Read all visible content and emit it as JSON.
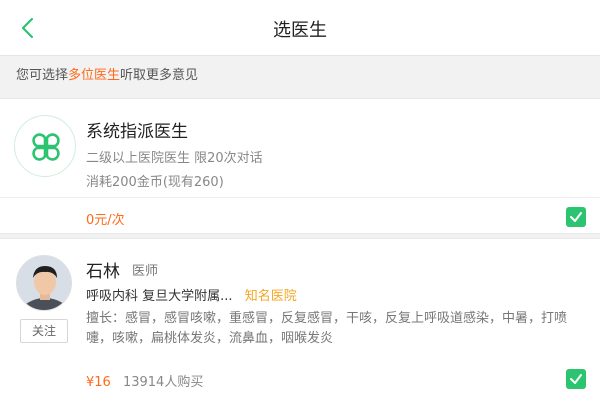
{
  "header": {
    "title": "选医生",
    "back_icon": "chevron-left-icon"
  },
  "hint": {
    "prefix": "您可选择",
    "highlight": "多位医生",
    "suffix": "听取更多意见"
  },
  "system_card": {
    "logo_icon": "clover-icon",
    "name": "系统指派医生",
    "desc": "二级以上医院医生 限20次对话",
    "cost": "消耗200金币(现有260)",
    "price": "0元/次",
    "checked": true
  },
  "doctor_card": {
    "name": "石林",
    "title": "医师",
    "department": "呼吸内科",
    "hospital": "复旦大学附属...",
    "hospital_tag": "知名医院",
    "follow_label": "关注",
    "skills": "擅长：感冒，感冒咳嗽，重感冒，反复感冒，干咳，反复上呼吸道感染，中暑，打喷嚏，咳嗽，扁桃体发炎，流鼻血，咽喉发炎",
    "price": "¥16",
    "buyers": "13914人购买",
    "checked": true
  },
  "colors": {
    "accent_green": "#2cc470",
    "highlight_orange": "#ff6a1a",
    "tag_yellow": "#f5a623"
  }
}
